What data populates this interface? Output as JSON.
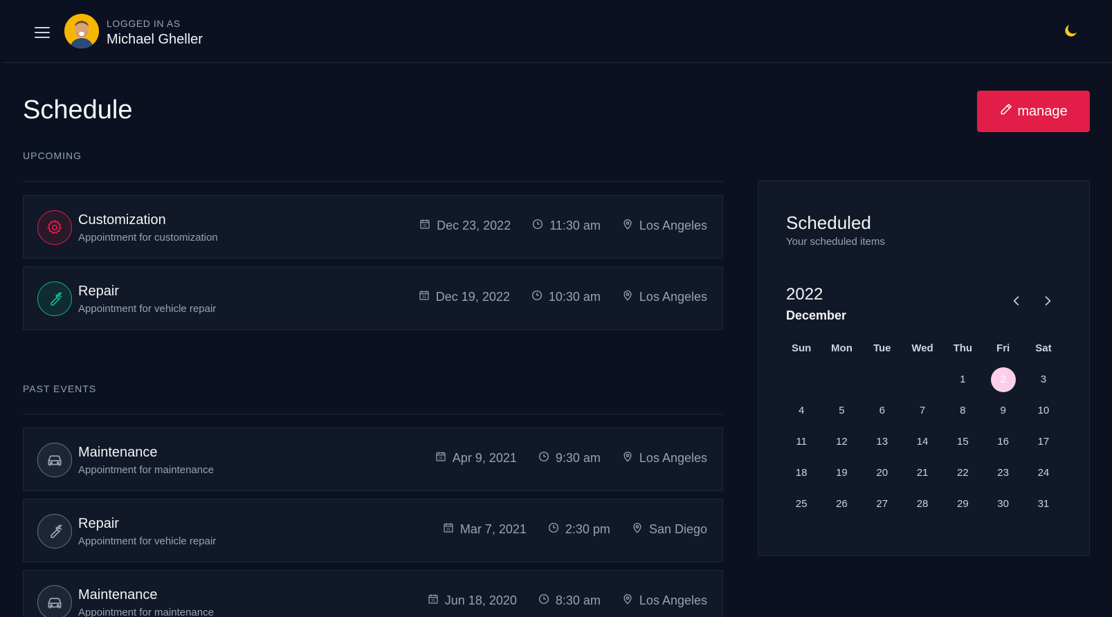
{
  "header": {
    "login_label": "LOGGED IN AS",
    "user_name": "Michael Gheller",
    "icons": {
      "menu": "hamburger-icon",
      "theme": "moon-icon",
      "avatar": "user-avatar"
    },
    "moon_color": "#facc15"
  },
  "page": {
    "title": "Schedule",
    "manage_label": "manage",
    "accent": "#e11d48"
  },
  "upcoming": {
    "label": "UPCOMING",
    "events": [
      {
        "title": "Customization",
        "subtitle": "Appointment for customization",
        "date": "Dec 23, 2022",
        "time": "11:30 am",
        "location": "Los Angeles",
        "icon": "gear-icon",
        "color": "#e11d48"
      },
      {
        "title": "Repair",
        "subtitle": "Appointment for vehicle repair",
        "date": "Dec 19, 2022",
        "time": "10:30 am",
        "location": "Los Angeles",
        "icon": "wrench-icon",
        "color": "#10b981"
      }
    ]
  },
  "past": {
    "label": "PAST EVENTS",
    "events": [
      {
        "title": "Maintenance",
        "subtitle": "Appointment for maintenance",
        "date": "Apr 9, 2021",
        "time": "9:30 am",
        "location": "Los Angeles",
        "icon": "car-icon",
        "color": "#6b7280"
      },
      {
        "title": "Repair",
        "subtitle": "Appointment for vehicle repair",
        "date": "Mar 7, 2021",
        "time": "2:30 pm",
        "location": "San Diego",
        "icon": "wrench-icon",
        "color": "#6b7280"
      },
      {
        "title": "Maintenance",
        "subtitle": "Appointment for maintenance",
        "date": "Jun 18, 2020",
        "time": "8:30 am",
        "location": "Los Angeles",
        "icon": "car-icon",
        "color": "#6b7280"
      }
    ]
  },
  "calendar": {
    "title": "Scheduled",
    "subtitle": "Your scheduled items",
    "year": "2022",
    "month": "December",
    "weekdays": [
      "Sun",
      "Mon",
      "Tue",
      "Wed",
      "Thu",
      "Fri",
      "Sat"
    ],
    "days": [
      "",
      "",
      "",
      "",
      "1",
      "2",
      "3",
      "4",
      "5",
      "6",
      "7",
      "8",
      "9",
      "10",
      "11",
      "12",
      "13",
      "14",
      "15",
      "16",
      "17",
      "18",
      "19",
      "20",
      "21",
      "22",
      "23",
      "24",
      "25",
      "26",
      "27",
      "28",
      "29",
      "30",
      "31"
    ],
    "selected_day": "2",
    "selected_color": "#fbcfe8"
  }
}
